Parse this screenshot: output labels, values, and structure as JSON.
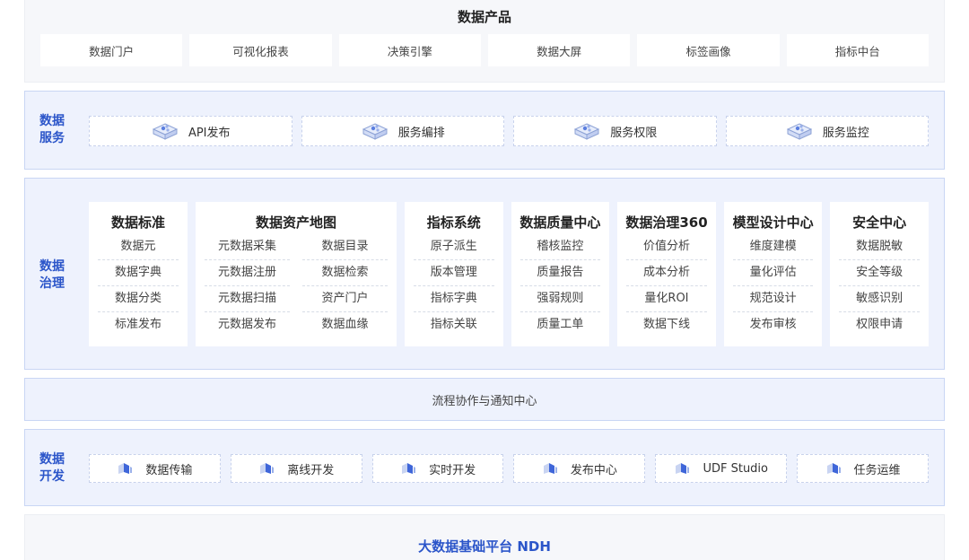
{
  "products": {
    "title": "数据产品",
    "items": [
      "数据门户",
      "可视化报表",
      "决策引擎",
      "数据大屏",
      "标签画像",
      "指标中台"
    ]
  },
  "services": {
    "label": "数据\n服务",
    "items": [
      "API发布",
      "服务编排",
      "服务权限",
      "服务监控"
    ],
    "icon": "cube-stack-icon"
  },
  "governance": {
    "label": "数据\n治理",
    "columns": [
      {
        "title": "数据标准",
        "items": [
          "数据元",
          "数据字典",
          "数据分类",
          "标准发布"
        ]
      },
      {
        "title": "数据资产地图",
        "items": [
          "元数据采集",
          "数据目录",
          "元数据注册",
          "数据检索",
          "元数据扫描",
          "资产门户",
          "元数据发布",
          "数据血缘"
        ]
      },
      {
        "title": "指标系统",
        "items": [
          "原子派生",
          "版本管理",
          "指标字典",
          "指标关联"
        ]
      },
      {
        "title": "数据质量中心",
        "items": [
          "稽核监控",
          "质量报告",
          "强弱规则",
          "质量工单"
        ]
      },
      {
        "title": "数据治理360",
        "items": [
          "价值分析",
          "成本分析",
          "量化ROI",
          "数据下线"
        ]
      },
      {
        "title": "模型设计中心",
        "items": [
          "维度建模",
          "量化评估",
          "规范设计",
          "发布审核"
        ]
      },
      {
        "title": "安全中心",
        "items": [
          "数据脱敏",
          "安全等级",
          "敏感识别",
          "权限申请"
        ]
      }
    ]
  },
  "flow": {
    "title": "流程协作与通知中心"
  },
  "development": {
    "label": "数据\n开发",
    "items": [
      "数据传输",
      "离线开发",
      "实时开发",
      "发布中心",
      "UDF Studio",
      "任务运维"
    ],
    "icon": "small-cube-icon"
  },
  "base": {
    "title": "大数据基础平台 NDH"
  },
  "colors": {
    "accent": "#2b55c9",
    "panel_bg": "#eef2fd",
    "panel_border": "#c9d6f4"
  }
}
